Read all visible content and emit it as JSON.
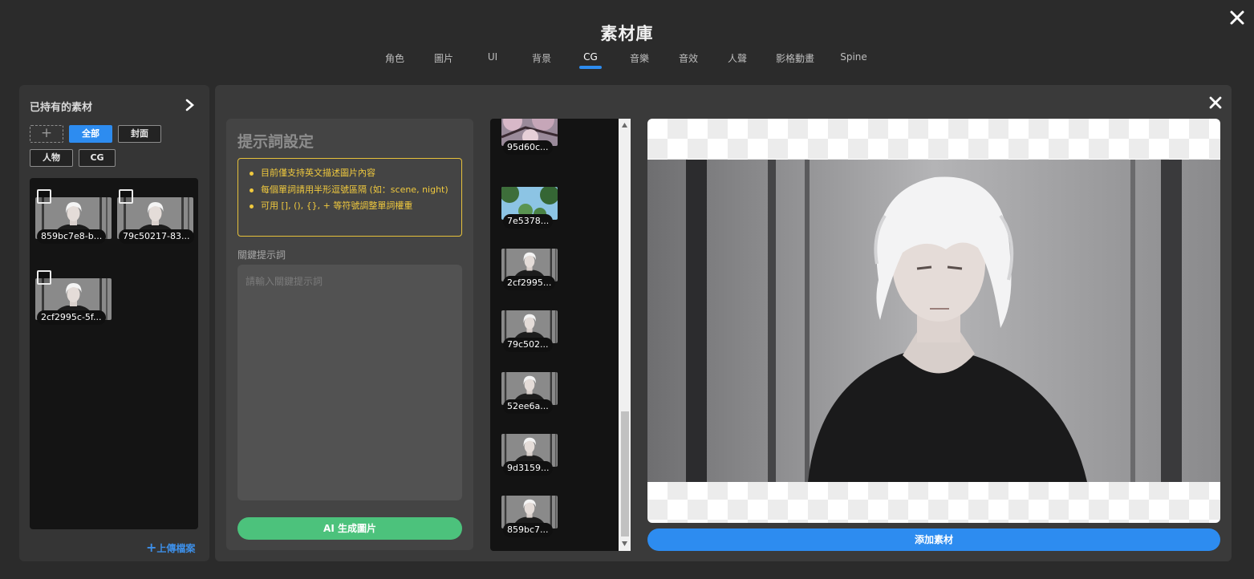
{
  "header": {
    "title": "素材庫",
    "tabs": [
      "角色",
      "圖片",
      "UI",
      "背景",
      "CG",
      "音樂",
      "音效",
      "人聲",
      "影格動畫",
      "Spine"
    ],
    "active_tab": "CG"
  },
  "owned_panel": {
    "title": "已持有的素材",
    "add_symbol": "+",
    "filters": [
      "全部",
      "封面",
      "人物",
      "CG"
    ],
    "active_filter": "全部",
    "items": [
      {
        "label": "859bc7e8-b..."
      },
      {
        "label": "79c50217-83..."
      },
      {
        "label": "2cf2995c-5f..."
      }
    ],
    "upload_label": "上傳檔案"
  },
  "prompt_panel": {
    "title": "提示詞設定",
    "notes": [
      "目前僅支持英文描述圖片內容",
      "每個單詞請用半形逗號區隔 (如：scene, night)",
      "可用 [], (), {}, + 等符號調整單詞權重"
    ],
    "keyword_label": "關鍵提示詞",
    "keyword_placeholder": "請輸入關鍵提示詞",
    "keyword_value": "",
    "generate_label": "AI 生成圖片"
  },
  "results": [
    {
      "label": "95d60c..."
    },
    {
      "label": "7e5378..."
    },
    {
      "label": "2cf2995..."
    },
    {
      "label": "79c502..."
    },
    {
      "label": "52ee6a..."
    },
    {
      "label": "9d3159..."
    },
    {
      "label": "859bc7..."
    }
  ],
  "preview": {
    "add_label": "添加素材"
  },
  "colors": {
    "accent": "#2d8cf0",
    "generate": "#4cc27c",
    "notice": "#f0c93e"
  }
}
